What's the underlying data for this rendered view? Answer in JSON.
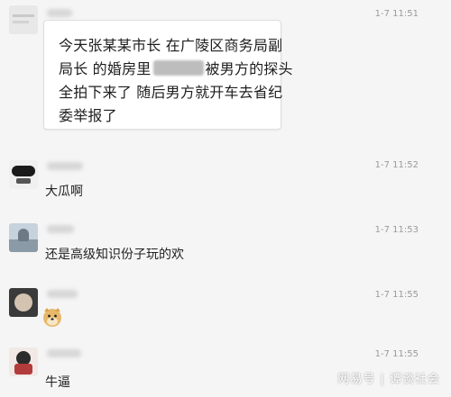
{
  "messages": [
    {
      "time": "1-7 11:51",
      "lines": [
        "今天张某某市长 在广陵区商务局副",
        "局长 的婚房里",
        "被男方的探头",
        "全拍下来了 随后男方就开车去省纪",
        "委举报了"
      ]
    },
    {
      "time": "1-7 11:52",
      "text": "大瓜啊"
    },
    {
      "time": "1-7 11:53",
      "text": "还是高级知识份子玩的欢"
    },
    {
      "time": "1-7 11:55",
      "text": ""
    },
    {
      "time": "1-7 11:55",
      "text": "牛逼"
    }
  ],
  "watermark": "网易号 | 谭谈社会",
  "colors": {
    "background": "#f5f5f5",
    "bubble": "#ffffff",
    "time": "#9a9a9a"
  },
  "icons": [
    "avatar-image",
    "doge-sticker"
  ]
}
